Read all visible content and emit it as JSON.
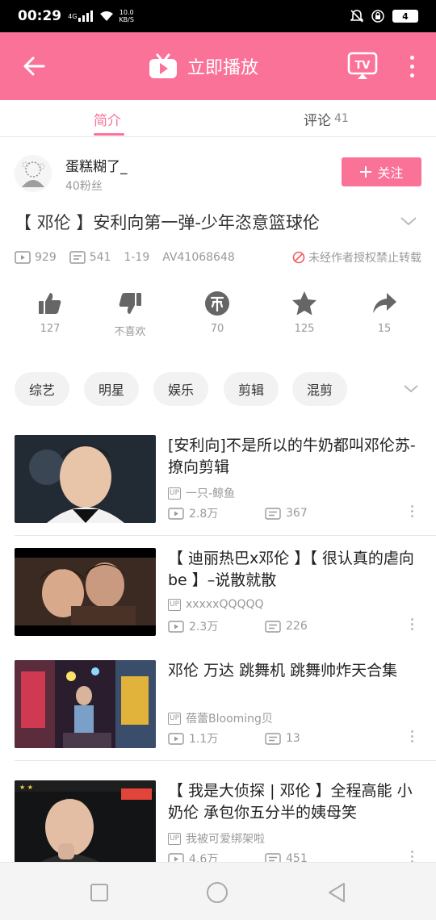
{
  "status_bar": {
    "time": "00:29",
    "network": "4G",
    "speed_value": "10.0",
    "speed_unit": "KB/S",
    "battery": "4"
  },
  "header": {
    "title": "立即播放",
    "back_icon": "arrow-left-icon",
    "tv_icon": "tv-cast-icon",
    "more_icon": "more-vertical-icon"
  },
  "tabs": [
    {
      "label": "简介",
      "active": true
    },
    {
      "label": "评论",
      "count": "41",
      "active": false
    }
  ],
  "author": {
    "name": "蛋糕糊了_",
    "fans": "40粉丝",
    "follow_label": "关注"
  },
  "video": {
    "title": "【 邓伦 】安利向第一弹-少年恣意篮球伦",
    "views": "929",
    "danmaku": "541",
    "date": "1-19",
    "av": "AV41068648",
    "no_repost": "未经作者授权禁止转载"
  },
  "actions": [
    {
      "icon": "thumb-up-icon",
      "label": "127"
    },
    {
      "icon": "thumb-down-icon",
      "label": "不喜欢"
    },
    {
      "icon": "coin-icon",
      "label": "70"
    },
    {
      "icon": "star-icon",
      "label": "125"
    },
    {
      "icon": "share-icon",
      "label": "15"
    }
  ],
  "tags": [
    "综艺",
    "明星",
    "娱乐",
    "剪辑",
    "混剪"
  ],
  "related": [
    {
      "title": "[安利向]不是所以的牛奶都叫邓伦苏-撩向剪辑",
      "up": "一只-鲸鱼",
      "views": "2.8万",
      "danmaku": "367"
    },
    {
      "title": "【 迪丽热巴x邓伦 】【 很认真的虐向 be 】–说散就散",
      "up": "xxxxxQQQQQ",
      "views": "2.3万",
      "danmaku": "226"
    },
    {
      "title": "邓伦 万达 跳舞机 跳舞帅炸天合集",
      "up": "蓓蕾Blooming贝",
      "views": "1.1万",
      "danmaku": "13"
    },
    {
      "title": "【 我是大侦探 | 邓伦 】全程高能 小奶伦 承包你五分半的姨母笑",
      "up": "我被可爱绑架啦",
      "views": "4.6万",
      "danmaku": "451"
    }
  ],
  "up_badge": "UP",
  "colors": {
    "brand": "#fb7299",
    "muted": "#999999"
  }
}
